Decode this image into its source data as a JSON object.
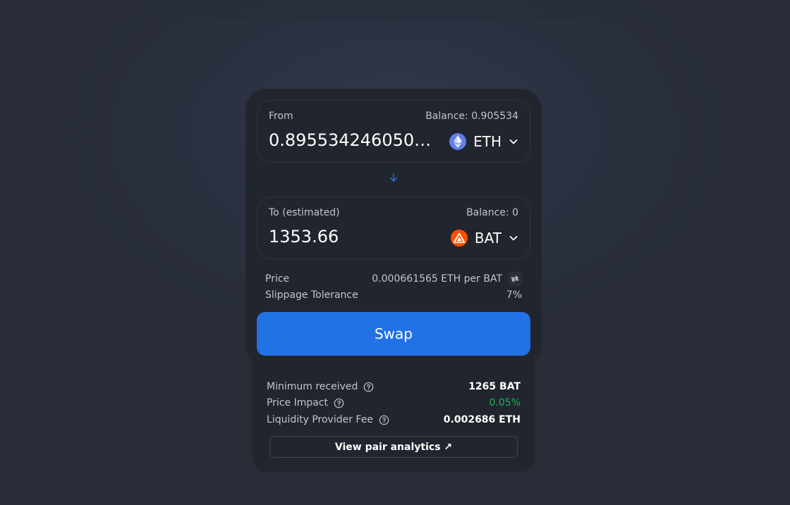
{
  "colors": {
    "background": "#2b3140",
    "card": "#21252d",
    "accent": "#2172e5",
    "positive": "#27ae60",
    "eth": "#627eea",
    "bat": "#ff5000"
  },
  "from": {
    "label": "From",
    "balance": "Balance: 0.905534",
    "amount": "0.8955342460502...",
    "token": "ETH",
    "icon": "eth-icon"
  },
  "to": {
    "label": "To (estimated)",
    "balance": "Balance: 0",
    "amount": "1353.66",
    "token": "BAT",
    "icon": "bat-icon"
  },
  "price": {
    "label": "Price",
    "value": "0.000661565 ETH per BAT"
  },
  "slippage": {
    "label": "Slippage Tolerance",
    "value": "7%"
  },
  "swap_button": "Swap",
  "details": {
    "minimum_received": {
      "label": "Minimum received",
      "value": "1265 BAT"
    },
    "price_impact": {
      "label": "Price Impact",
      "value": "0.05%"
    },
    "lp_fee": {
      "label": "Liquidity Provider Fee",
      "value": "0.002686 ETH"
    },
    "analytics_link": "View pair analytics ↗"
  }
}
